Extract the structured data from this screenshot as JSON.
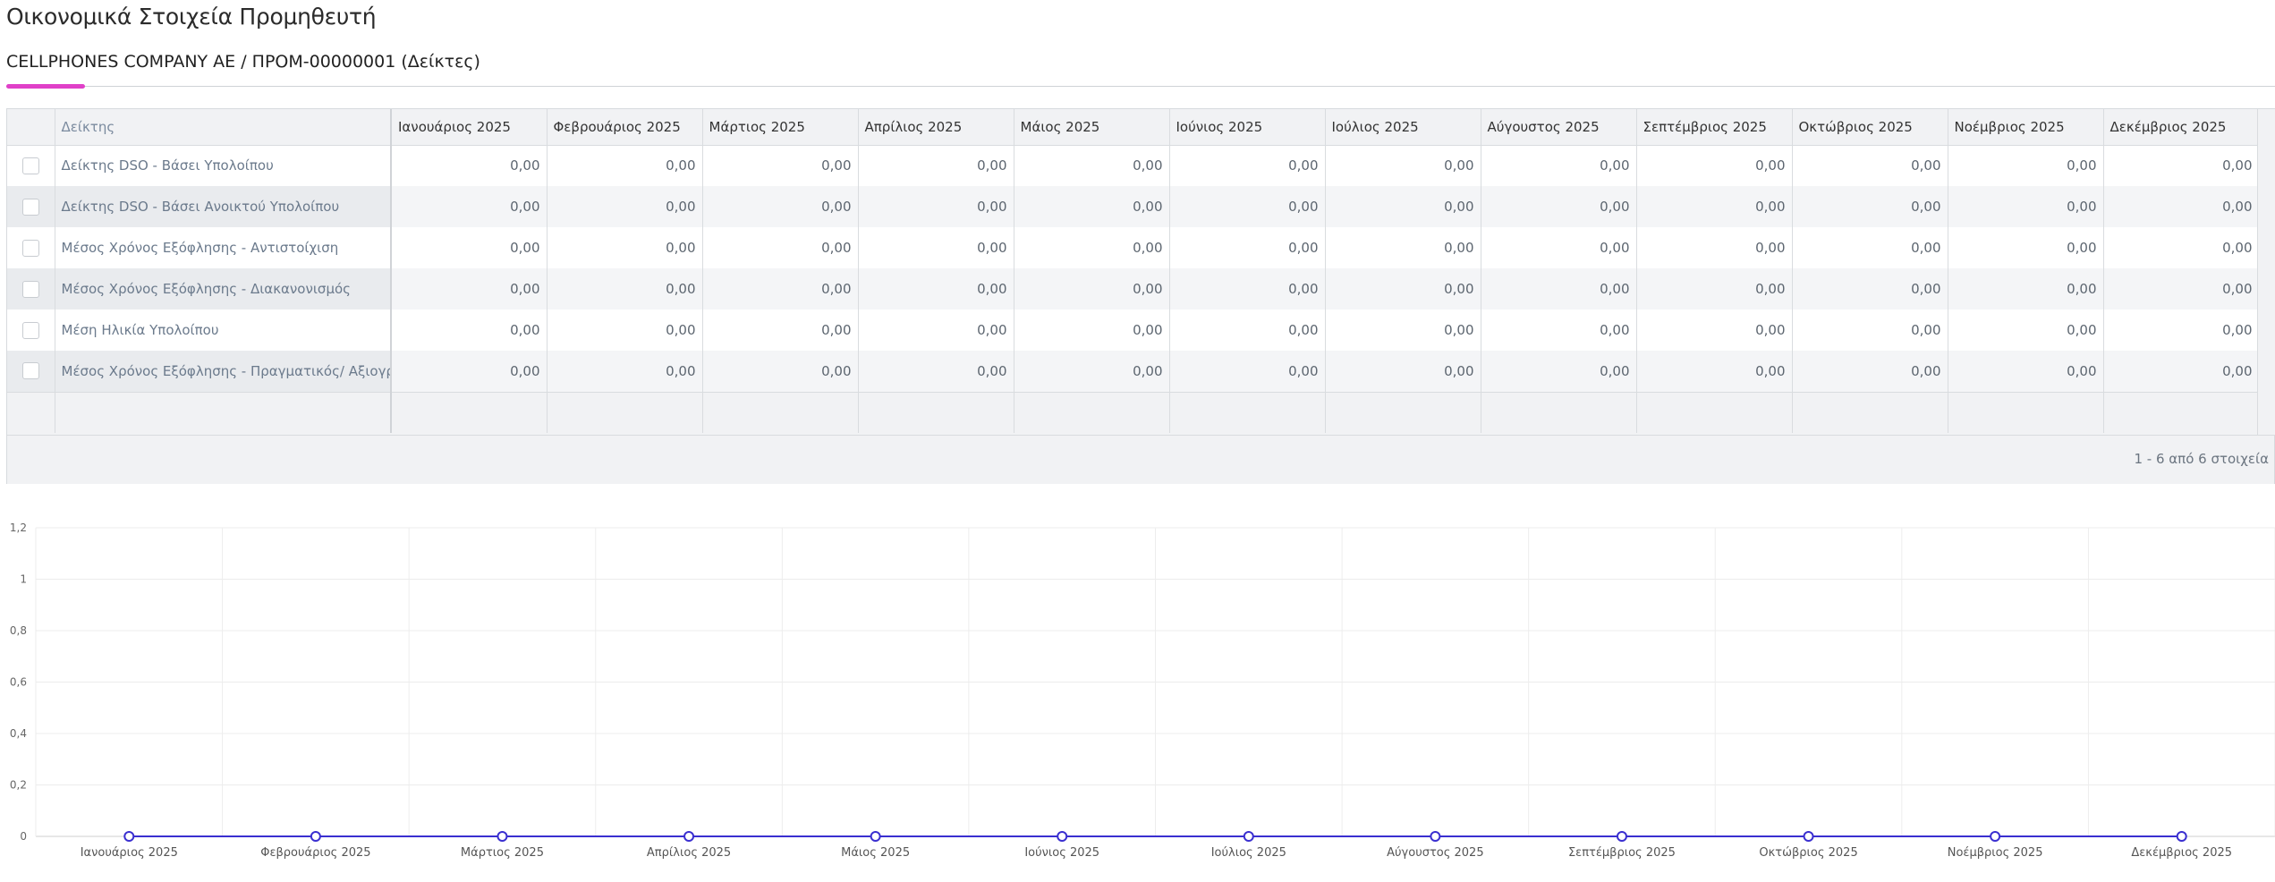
{
  "page": {
    "title": "Οικονομικά Στοιχεία Προμηθευτή",
    "tab_label": "CELLPHONES COMPANY AE / ΠΡΟΜ-00000001 (Δείκτες)"
  },
  "grid": {
    "name_header": "Δείκτης",
    "months": [
      "Ιανουάριος 2025",
      "Φεβρουάριος 2025",
      "Μάρτιος 2025",
      "Απρίλιος 2025",
      "Μάιος 2025",
      "Ιούνιος 2025",
      "Ιούλιος 2025",
      "Αύγουστος 2025",
      "Σεπτέμβριος 2025",
      "Οκτώβριος 2025",
      "Νοέμβριος 2025",
      "Δεκέμβριος 2025"
    ],
    "rows": [
      {
        "name": "Δείκτης DSO - Βάσει Υπολοίπου",
        "values": [
          "0,00",
          "0,00",
          "0,00",
          "0,00",
          "0,00",
          "0,00",
          "0,00",
          "0,00",
          "0,00",
          "0,00",
          "0,00",
          "0,00"
        ]
      },
      {
        "name": "Δείκτης DSO - Βάσει Ανοικτού Υπολοίπου",
        "values": [
          "0,00",
          "0,00",
          "0,00",
          "0,00",
          "0,00",
          "0,00",
          "0,00",
          "0,00",
          "0,00",
          "0,00",
          "0,00",
          "0,00"
        ]
      },
      {
        "name": "Μέσος Χρόνος Εξόφλησης - Αντιστοίχιση",
        "values": [
          "0,00",
          "0,00",
          "0,00",
          "0,00",
          "0,00",
          "0,00",
          "0,00",
          "0,00",
          "0,00",
          "0,00",
          "0,00",
          "0,00"
        ]
      },
      {
        "name": "Μέσος Χρόνος Εξόφλησης - Διακανονισμός",
        "values": [
          "0,00",
          "0,00",
          "0,00",
          "0,00",
          "0,00",
          "0,00",
          "0,00",
          "0,00",
          "0,00",
          "0,00",
          "0,00",
          "0,00"
        ]
      },
      {
        "name": "Μέση Ηλικία Υπολοίπου",
        "values": [
          "0,00",
          "0,00",
          "0,00",
          "0,00",
          "0,00",
          "0,00",
          "0,00",
          "0,00",
          "0,00",
          "0,00",
          "0,00",
          "0,00"
        ]
      },
      {
        "name": "Μέσος Χρόνος Εξόφλησης - Πραγματικός/ Αξιογράφα",
        "values": [
          "0,00",
          "0,00",
          "0,00",
          "0,00",
          "0,00",
          "0,00",
          "0,00",
          "0,00",
          "0,00",
          "0,00",
          "0,00",
          "0,00"
        ]
      }
    ],
    "pager_info": "1 - 6 από 6 στοιχεία"
  },
  "chart_data": {
    "type": "line",
    "categories": [
      "Ιανουάριος 2025",
      "Φεβρουάριος 2025",
      "Μάρτιος 2025",
      "Απρίλιος 2025",
      "Μάιος 2025",
      "Ιούνιος 2025",
      "Ιούλιος 2025",
      "Αύγουστος 2025",
      "Σεπτέμβριος 2025",
      "Οκτώβριος 2025",
      "Νοέμβριος 2025",
      "Δεκέμβριος 2025"
    ],
    "series": [
      {
        "values": [
          0,
          0,
          0,
          0,
          0,
          0,
          0,
          0,
          0,
          0,
          0,
          0
        ],
        "color": "#3a2fd0"
      }
    ],
    "ylim": [
      0,
      1.2
    ],
    "y_ticks": [
      "0",
      "0,2",
      "0,4",
      "0,6",
      "0,8",
      "1",
      "1,2"
    ],
    "grid": true
  }
}
